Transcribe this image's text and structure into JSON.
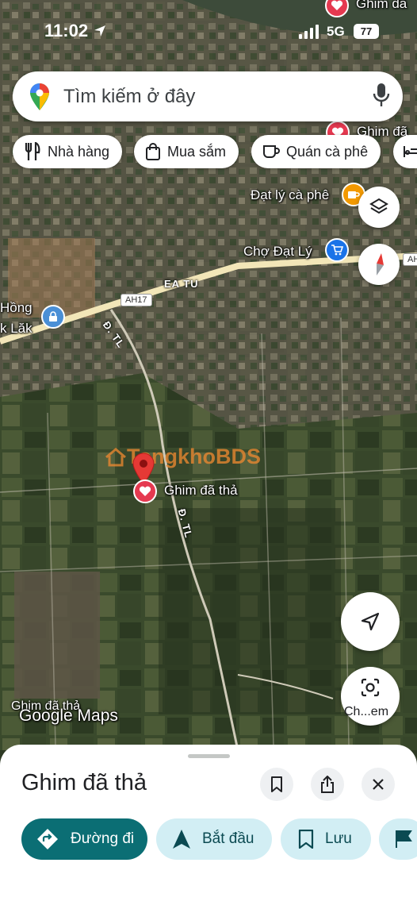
{
  "status_bar": {
    "time": "11:02",
    "network": "5G",
    "battery": "77"
  },
  "search": {
    "placeholder": "Tìm kiếm ở đây"
  },
  "chips": [
    "Nhà hàng",
    "Mua sắm",
    "Quán cà phê"
  ],
  "map": {
    "labels": {
      "top_pin": "Ghim đã",
      "right_pin": "Ghim đã",
      "cafe": "Đạt lý cà phê",
      "market": "Chợ Đạt Lý",
      "road_ah_right": "AH",
      "hong": "Hồng",
      "lak": "k Lăk",
      "ea_tu": "EA TU",
      "ah17": "AH17",
      "road_dtl_1": "Đ. TL",
      "road_dtl_2": "Đ. TL",
      "dropped_pin": "Ghim đã thả",
      "bottom_pin": "Ghim đã thả",
      "watermark": "TongkhoBDS",
      "google_maps": "Google Maps"
    },
    "lens_label": "Ch...em",
    "colors": {
      "accent_pin": "#e53950",
      "cafe": "#f29900",
      "market": "#1a73e8",
      "road": "#f2e6b8"
    }
  },
  "sheet": {
    "title": "Ghim đã thả",
    "actions": {
      "directions": "Đường đi",
      "start": "Bắt đầu",
      "save": "Lưu"
    }
  }
}
